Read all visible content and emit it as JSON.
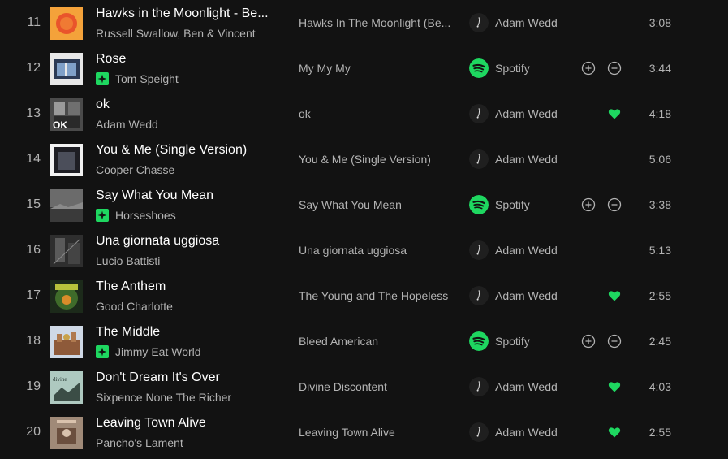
{
  "colors": {
    "background": "#121212",
    "accent": "#1ed760",
    "text_primary": "#ffffff",
    "text_secondary": "#b3b3b3"
  },
  "tracks": [
    {
      "number": "11",
      "title": "Hawks in the Moonlight - Be...",
      "artist": "Russell Swallow, Ben & Vincent",
      "ai_badge": false,
      "album": "Hawks In The Moonlight (Be...",
      "added_by": "Adam Wedd",
      "added_by_icon": "user-avatar-icon",
      "liked": false,
      "actions": false,
      "duration": "3:08",
      "cover": "orange"
    },
    {
      "number": "12",
      "title": "Rose",
      "artist": "Tom Speight",
      "ai_badge": true,
      "album": "My My My",
      "added_by": "Spotify",
      "added_by_icon": "spotify-logo-icon",
      "liked": false,
      "actions": true,
      "duration": "3:44",
      "cover": "window"
    },
    {
      "number": "13",
      "title": "ok",
      "artist": "Adam Wedd",
      "ai_badge": false,
      "album": "ok",
      "added_by": "Adam Wedd",
      "added_by_icon": "user-avatar-icon",
      "liked": true,
      "actions": false,
      "duration": "4:18",
      "cover": "ok"
    },
    {
      "number": "14",
      "title": "You & Me (Single Version)",
      "artist": "Cooper Chasse",
      "ai_badge": false,
      "album": "You & Me (Single Version)",
      "added_by": "Adam Wedd",
      "added_by_icon": "user-avatar-icon",
      "liked": false,
      "actions": false,
      "duration": "5:06",
      "cover": "frame"
    },
    {
      "number": "15",
      "title": "Say What You Mean",
      "artist": "Horseshoes",
      "ai_badge": true,
      "album": "Say What You Mean",
      "added_by": "Spotify",
      "added_by_icon": "spotify-logo-icon",
      "liked": false,
      "actions": true,
      "duration": "3:38",
      "cover": "gray"
    },
    {
      "number": "16",
      "title": "Una giornata uggiosa",
      "artist": "Lucio Battisti",
      "ai_badge": false,
      "album": "Una giornata uggiosa",
      "added_by": "Adam Wedd",
      "added_by_icon": "user-avatar-icon",
      "liked": false,
      "actions": false,
      "duration": "5:13",
      "cover": "dark"
    },
    {
      "number": "17",
      "title": "The Anthem",
      "artist": "Good Charlotte",
      "ai_badge": false,
      "album": "The Young and The Hopeless",
      "added_by": "Adam Wedd",
      "added_by_icon": "user-avatar-icon",
      "liked": true,
      "actions": false,
      "duration": "2:55",
      "cover": "green"
    },
    {
      "number": "18",
      "title": "The Middle",
      "artist": "Jimmy Eat World",
      "ai_badge": true,
      "album": "Bleed American",
      "added_by": "Spotify",
      "added_by_icon": "spotify-logo-icon",
      "liked": false,
      "actions": true,
      "duration": "2:45",
      "cover": "city"
    },
    {
      "number": "19",
      "title": "Don't Dream It's Over",
      "artist": "Sixpence None The Richer",
      "ai_badge": false,
      "album": "Divine Discontent",
      "added_by": "Adam Wedd",
      "added_by_icon": "user-avatar-icon",
      "liked": true,
      "actions": false,
      "duration": "4:03",
      "cover": "teal"
    },
    {
      "number": "20",
      "title": "Leaving Town Alive",
      "artist": "Pancho's Lament",
      "ai_badge": false,
      "album": "Leaving Town Alive",
      "added_by": "Adam Wedd",
      "added_by_icon": "user-avatar-icon",
      "liked": true,
      "actions": false,
      "duration": "2:55",
      "cover": "beige"
    }
  ]
}
